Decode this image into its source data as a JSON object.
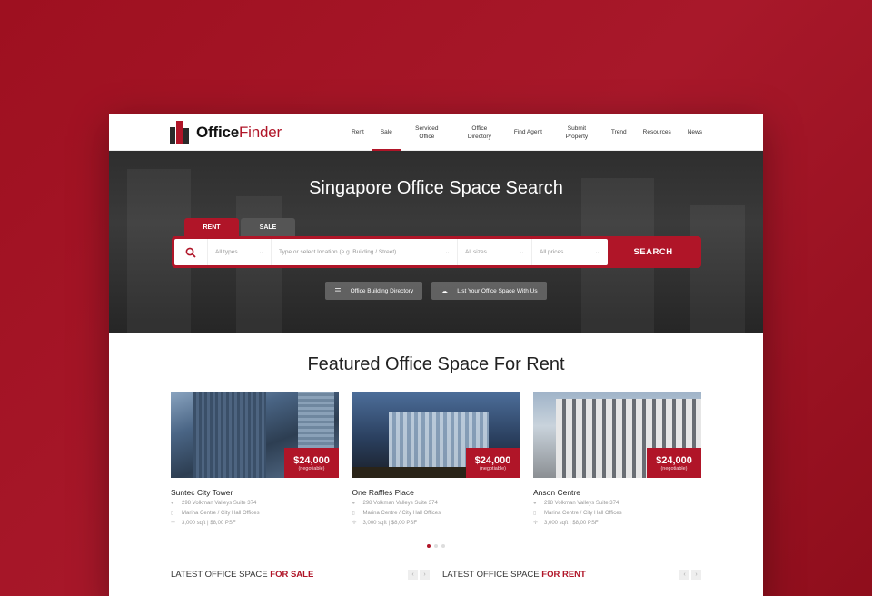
{
  "colors": {
    "brand": "#b01528",
    "background": "#a01426"
  },
  "brand": {
    "name_bold": "Office",
    "name_light": "Finder"
  },
  "nav": [
    {
      "label": "Rent",
      "active": false
    },
    {
      "label": "Sale",
      "active": true
    },
    {
      "label": "Serviced Office",
      "active": false
    },
    {
      "label": "Office Directory",
      "active": false
    },
    {
      "label": "Find Agent",
      "active": false
    },
    {
      "label": "Submit Property",
      "active": false
    },
    {
      "label": "Trend",
      "active": false
    },
    {
      "label": "Resources",
      "active": false
    },
    {
      "label": "News",
      "active": false
    }
  ],
  "hero": {
    "title": "Singapore Office Space Search",
    "tabs": {
      "rent": "RENT",
      "sale": "SALE",
      "selected": "RENT"
    },
    "search": {
      "type_value": "All types",
      "location_placeholder": "Type or select location (e.g. Building / Street)",
      "size_value": "All sizes",
      "price_value": "All prices",
      "button_label": "SEARCH",
      "icon": "search-icon"
    },
    "buttons": [
      {
        "label": "Office Building Directory",
        "icon": "list-icon"
      },
      {
        "label": "List Your Office Space With Us",
        "icon": "cloud-upload-icon"
      }
    ]
  },
  "featured": {
    "title": "Featured Office Space For Rent",
    "cards": [
      {
        "name": "Suntec City Tower",
        "price": "$24,000",
        "price_note": "(negotiable)",
        "address": "298 Volkman Valleys Suite 374",
        "area": "Marina Centre / City Hall Offices",
        "size": "3,000 sqft | $8,00 PSF"
      },
      {
        "name": "One Raffles Place",
        "price": "$24,000",
        "price_note": "(negotiable)",
        "address": "298 Volkman Valleys Suite 374",
        "area": "Marina Centre / City Hall Offices",
        "size": "3,000 sqft | $8,00 PSF"
      },
      {
        "name": "Anson Centre",
        "price": "$24,000",
        "price_note": "(negotiable)",
        "address": "298 Volkman Valleys Suite 374",
        "area": "Marina Centre / City Hall Offices",
        "size": "3,000 sqft | $8,00 PSF"
      }
    ],
    "carousel": {
      "pages": 3,
      "current": 1
    }
  },
  "latest": [
    {
      "prefix": "LATEST OFFICE SPACE ",
      "accent": "FOR SALE"
    },
    {
      "prefix": "LATEST OFFICE SPACE ",
      "accent": "FOR RENT"
    }
  ]
}
